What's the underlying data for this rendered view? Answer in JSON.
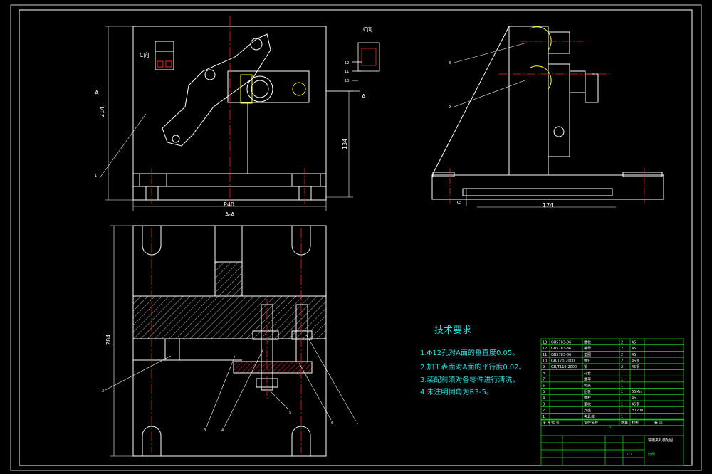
{
  "view_labels": {
    "c_view": "C向",
    "c_view_detail": "C向",
    "section_aa": "A-A",
    "arrow_a": "A",
    "arrow_a_left": "A"
  },
  "dimensions": {
    "front_height": "214",
    "front_width": "P40",
    "front_inner_height": "134",
    "side_width": "174",
    "side_small": "6",
    "section_height": "284"
  },
  "balloons": {
    "front_leader": "1",
    "detail_12": "12",
    "detail_11": "11",
    "detail_10": "10",
    "side_8": "8",
    "side_9": "9",
    "sec_2": "2",
    "sec_3": "3",
    "sec_4": "4",
    "sec_5": "5",
    "sec_6": "6",
    "sec_7": "7"
  },
  "tech_requirements": {
    "title": "技术要求",
    "items": [
      "1.Φ12孔对A面的垂直度0.05。",
      "2.加工表面对A面的平行度0.02。",
      "3.装配前须对各零件进行清洗。",
      "4.未注明倒角为R3-5。"
    ]
  },
  "bom_rows": [
    {
      "no": "13",
      "code": "GB5783-86",
      "name": "螺栓",
      "qty": "2",
      "mat": "45"
    },
    {
      "no": "12",
      "code": "GB5783-86",
      "name": "螺母",
      "qty": "2",
      "mat": "45"
    },
    {
      "no": "11",
      "code": "GB5783-86",
      "name": "垫圈",
      "qty": "2",
      "mat": "45"
    },
    {
      "no": "10",
      "code": "GB/T70-2000",
      "name": "螺钉",
      "qty": "2",
      "mat": "45钢"
    },
    {
      "no": "9",
      "code": "GB/T119-2000",
      "name": "销",
      "qty": "2",
      "mat": "45钢"
    },
    {
      "no": "8",
      "code": "",
      "name": "衬套",
      "qty": "1",
      "mat": ""
    },
    {
      "no": "7",
      "code": "",
      "name": "螺母",
      "qty": "1",
      "mat": ""
    },
    {
      "no": "6",
      "code": "",
      "name": "钩头",
      "qty": "1",
      "mat": ""
    },
    {
      "no": "5",
      "code": "",
      "name": "压板",
      "qty": "1",
      "mat": "65Mn"
    },
    {
      "no": "4",
      "code": "",
      "name": "螺柱",
      "qty": "1",
      "mat": "45"
    },
    {
      "no": "3",
      "code": "",
      "name": "垫块",
      "qty": "1",
      "mat": "45钢"
    },
    {
      "no": "2",
      "code": "",
      "name": "支座",
      "qty": "1",
      "mat": "HT200"
    },
    {
      "no": "1",
      "code": "",
      "name": "夹具体",
      "qty": "1",
      "mat": ""
    }
  ],
  "bom_header": {
    "no": "序 号",
    "code": "代 号",
    "name": "零件名称",
    "qty": "数量",
    "mat": "材料",
    "remark": "备 注"
  },
  "title_block": {
    "drawing_name": "铣槽夹具装配图",
    "unit_code": "01",
    "sheet_label": "1:1",
    "scale_label": "比例"
  },
  "colors": {
    "background": "#000000",
    "outline": "#ffffff",
    "center_line": "#ff2020",
    "dimension": "#19e6e6",
    "hidden": "#ffff00",
    "title_block": "#19e619"
  }
}
